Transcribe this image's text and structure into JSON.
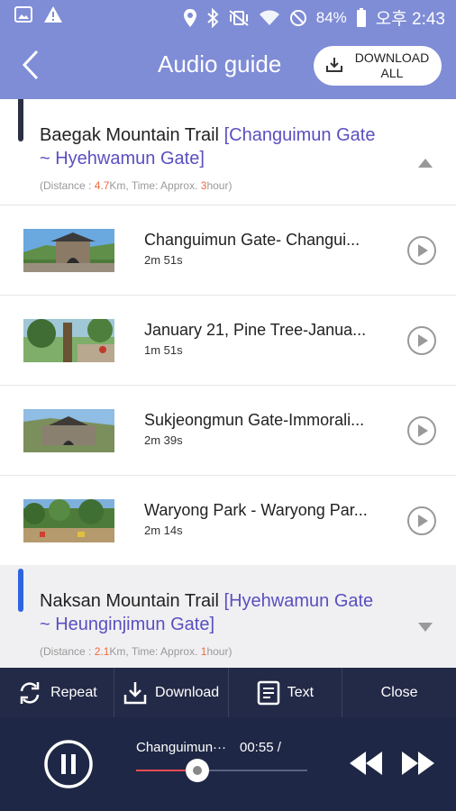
{
  "status_bar": {
    "battery": "84%",
    "time": "오후 2:43"
  },
  "header": {
    "title": "Audio guide",
    "download_all": "DOWNLOAD\nALL"
  },
  "sections": [
    {
      "name": "Baegak Mountain Trail",
      "range_line1": "[Changuimun Gate",
      "range_line2": "~ Hyehwamun Gate]",
      "meta_prefix": "(Distance : ",
      "distance": "4.7",
      "meta_mid": "Km, Time: Approx. ",
      "time": "3",
      "meta_suffix": "hour)",
      "expanded": true
    },
    {
      "name": "Naksan Mountain Trail",
      "range_line1": "[Hyehwamun Gate",
      "range_line2": "~ Heunginjimun Gate]",
      "meta_prefix": "(Distance : ",
      "distance": "2.1",
      "meta_mid": "Km, Time: Approx. ",
      "time": "1",
      "meta_suffix": "hour)",
      "expanded": false
    }
  ],
  "tracks": [
    {
      "title": "Changuimun Gate- Changui...",
      "duration": "2m 51s"
    },
    {
      "title": "January 21, Pine Tree-Janua...",
      "duration": "1m 51s"
    },
    {
      "title": "Sukjeongmun Gate-Immorali...",
      "duration": "2m 39s"
    },
    {
      "title": "Waryong Park - Waryong Par...",
      "duration": "2m 14s"
    }
  ],
  "actions": {
    "repeat": "Repeat",
    "download": "Download",
    "text": "Text",
    "close": "Close"
  },
  "player": {
    "now_playing": "Changuimun···",
    "elapsed": "00:55 /",
    "progress": 0.36
  },
  "colors": {
    "header": "#7f8cd6",
    "accent_purple": "#5a4fc0",
    "highlight_orange": "#ef6b3c",
    "player_bg": "#1e2745",
    "progress_red": "#ef4b52"
  }
}
